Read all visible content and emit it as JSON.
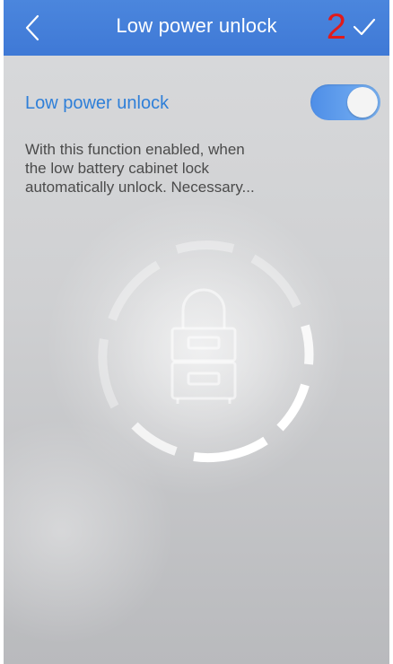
{
  "header": {
    "title": "Low power unlock",
    "badge": "2",
    "back_icon": "chevron-left-icon",
    "confirm_icon": "check-icon"
  },
  "setting": {
    "label": "Low power unlock",
    "enabled": true
  },
  "description": {
    "line1": "With this function enabled, when",
    "line2": "the low battery cabinet lock",
    "line3": "automatically unlock. Necessary..."
  },
  "status_graphic": {
    "icon": "cabinet-lock-icon"
  },
  "colors": {
    "nav_blue": "#3f79d6",
    "label_blue": "#2f7fd8",
    "badge_red": "#e11b1b"
  }
}
